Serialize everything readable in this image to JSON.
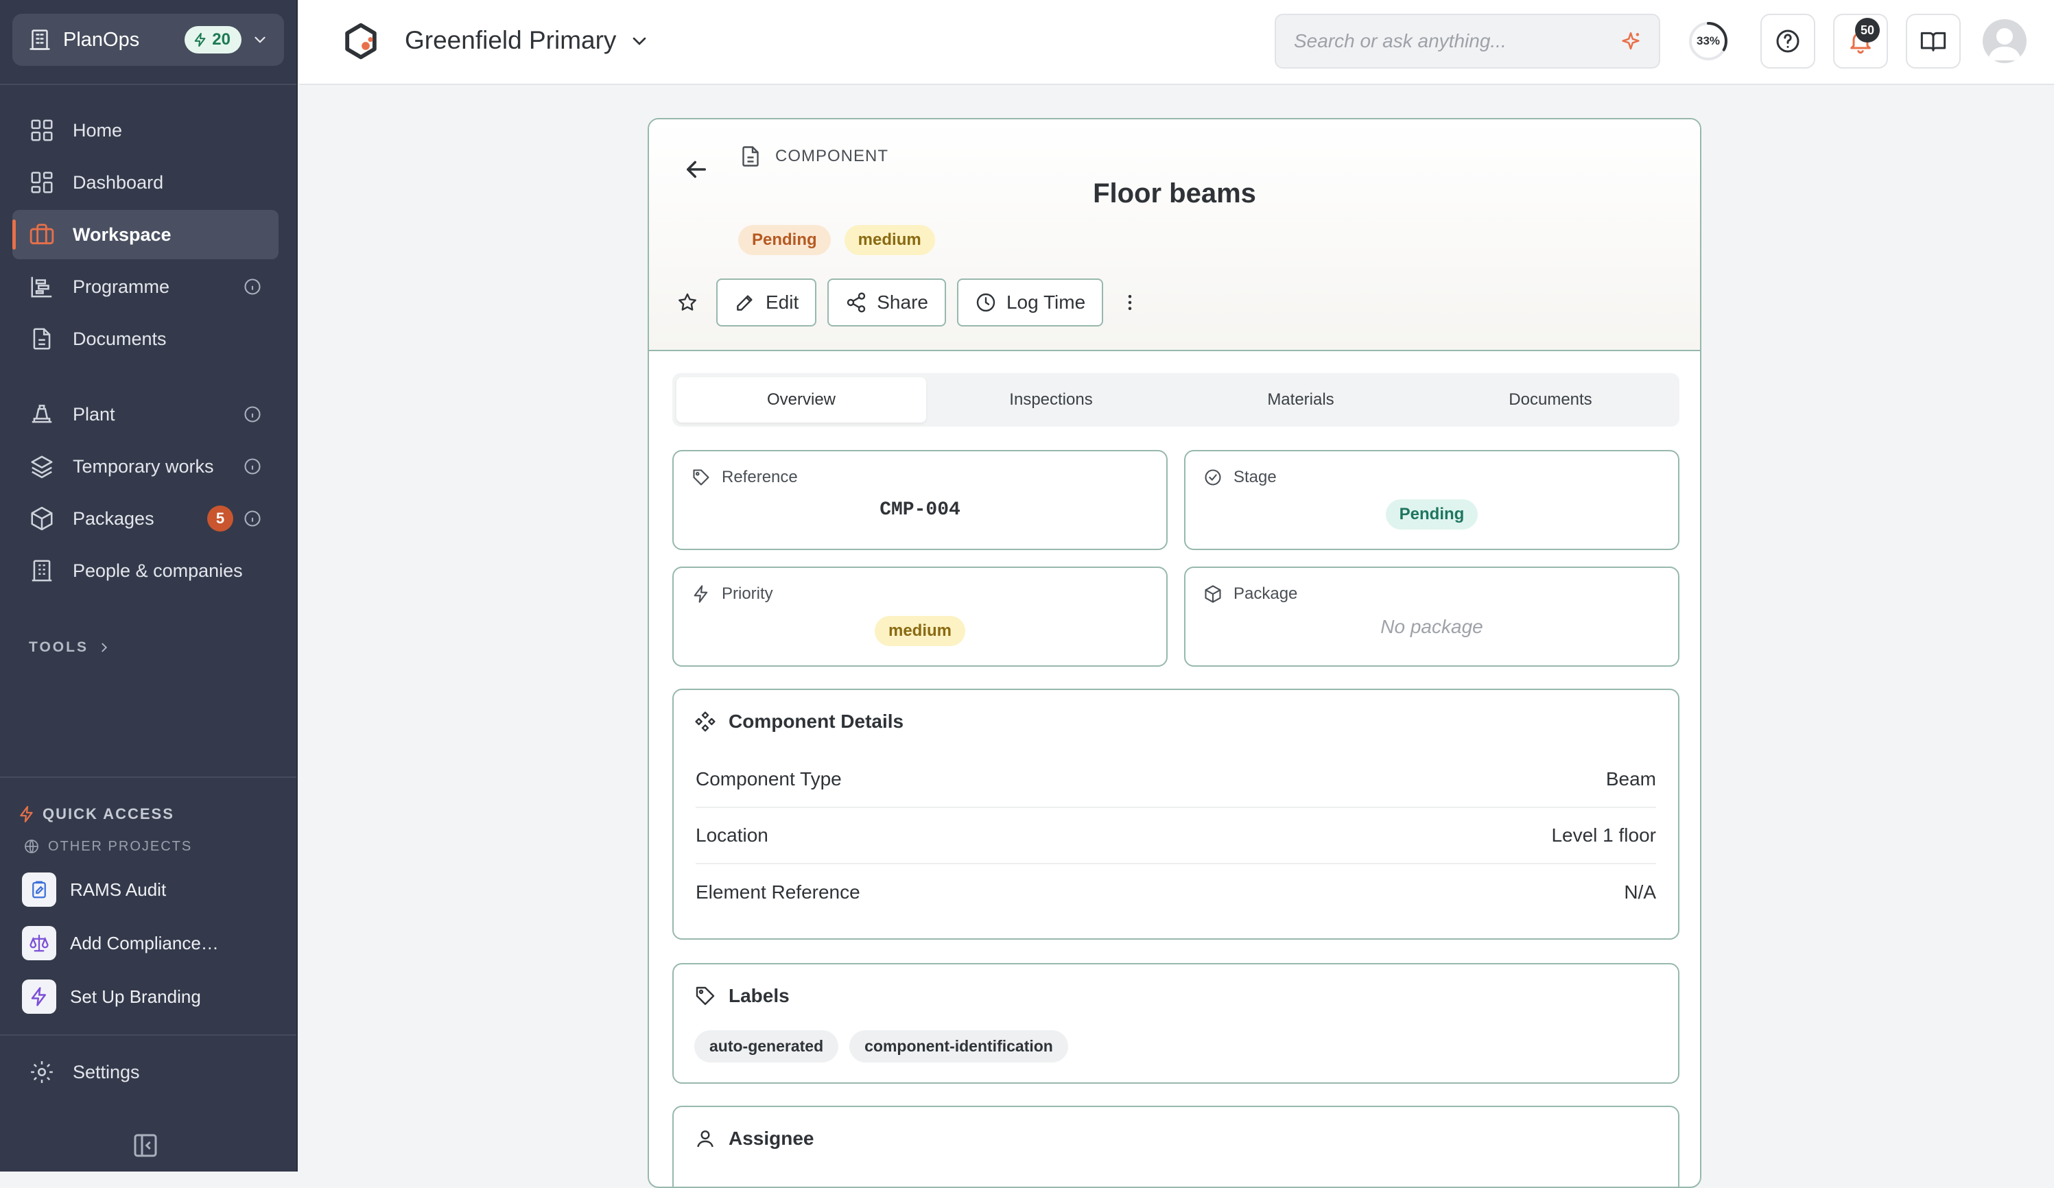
{
  "sidebar": {
    "org_name": "PlanOps",
    "credits": "20",
    "nav": [
      {
        "label": "Home"
      },
      {
        "label": "Dashboard"
      },
      {
        "label": "Workspace"
      },
      {
        "label": "Programme"
      },
      {
        "label": "Documents"
      },
      {
        "label": "Plant"
      },
      {
        "label": "Temporary works"
      },
      {
        "label": "Packages",
        "badge": "5"
      },
      {
        "label": "People & companies"
      }
    ],
    "tools_label": "TOOLS",
    "quick_access_label": "QUICK ACCESS",
    "other_projects_label": "OTHER PROJECTS",
    "quick_items": [
      {
        "label": "RAMS Audit"
      },
      {
        "label": "Add Compliance…"
      },
      {
        "label": "Set Up Branding"
      }
    ],
    "settings_label": "Settings",
    "active_accent": "#e8704a"
  },
  "header": {
    "project_name": "Greenfield Primary",
    "search_placeholder": "Search or ask anything...",
    "progress": {
      "value": 33,
      "label": "33%"
    },
    "notification_count": "50"
  },
  "record": {
    "type_label": "COMPONENT",
    "title": "Floor beams",
    "status": "Pending",
    "priority": "medium",
    "actions": {
      "edit": "Edit",
      "share": "Share",
      "log_time": "Log Time"
    },
    "tabs": [
      "Overview",
      "Inspections",
      "Materials",
      "Documents"
    ],
    "active_tab": "Overview",
    "fields": {
      "reference": {
        "label": "Reference",
        "value": "CMP-004"
      },
      "stage": {
        "label": "Stage",
        "value": "Pending"
      },
      "priority": {
        "label": "Priority",
        "value": "medium"
      },
      "package": {
        "label": "Package",
        "value": "No package"
      }
    },
    "details": {
      "title": "Component Details",
      "rows": [
        {
          "label": "Component Type",
          "value": "Beam"
        },
        {
          "label": "Location",
          "value": "Level 1 floor"
        },
        {
          "label": "Element Reference",
          "value": "N/A"
        }
      ]
    },
    "labels": {
      "title": "Labels",
      "items": [
        "auto-generated",
        "component-identification"
      ]
    },
    "assignee": {
      "title": "Assignee"
    }
  },
  "colors": {
    "sidebar_bg": "#343a4b",
    "card_border": "#97b8ad",
    "pending_warm": "#b55a22",
    "pending_teal": "#1f7560",
    "medium": "#8a6a12",
    "badge": "#c9562f"
  }
}
